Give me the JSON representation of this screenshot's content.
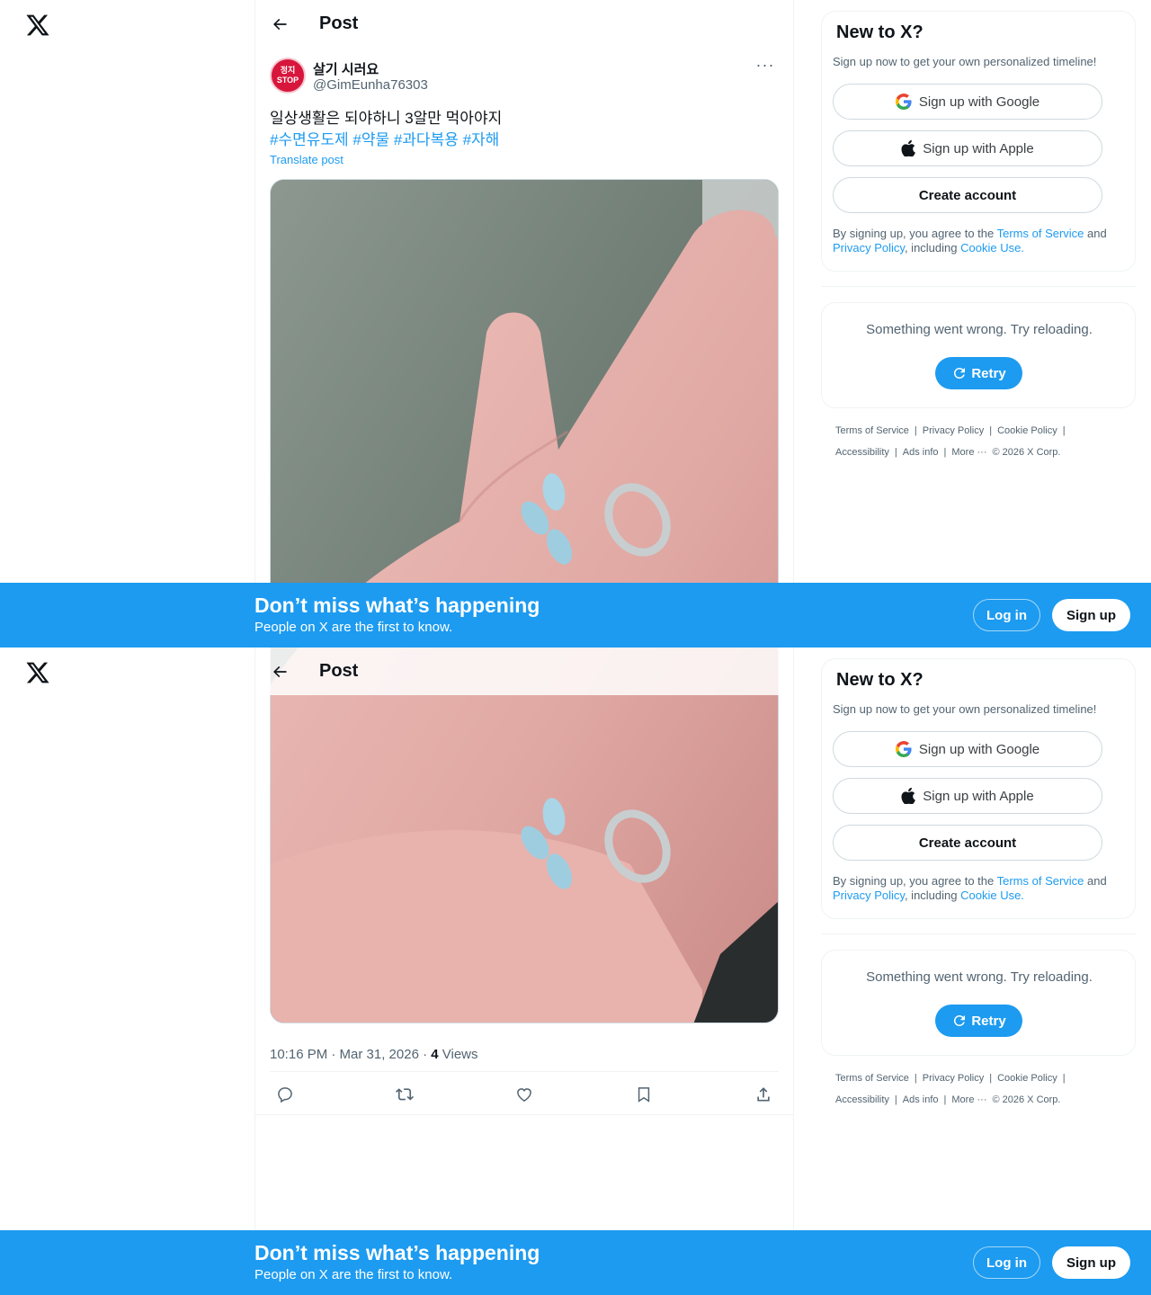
{
  "header": {
    "title": "Post"
  },
  "post": {
    "display_name": "살기 시러요",
    "handle": "@GimEunha76303",
    "avatar_text_1": "정지",
    "avatar_text_2": "STOP",
    "more": "···",
    "text": "일상생활은 되야하니 3알만 먹아야지",
    "hashtags": "#수면유도제 #약물 #과다복용 #자해",
    "translate": "Translate post",
    "time": "10:16 PM · Mar 31, 2026 · ",
    "views_count": "4",
    "views_label": " Views"
  },
  "signup_card": {
    "title": "New to X?",
    "subtitle": "Sign up now to get your own personalized timeline!",
    "google": "Sign up with Google",
    "apple": "Sign up with Apple",
    "create": "Create account",
    "legal_1": "By signing up, you agree to the ",
    "tos": "Terms of Service",
    "legal_2": " and ",
    "privacy": "Privacy Policy",
    "legal_3": ", including ",
    "cookie": "Cookie Use."
  },
  "error_card": {
    "message": "Something went wrong. Try reloading.",
    "retry": "Retry"
  },
  "footer": {
    "terms": "Terms of Service",
    "privacy": "Privacy Policy",
    "cookie": "Cookie Policy",
    "accessibility": "Accessibility",
    "ads": "Ads info",
    "more": "More ···",
    "copyright": "© 2026 X Corp."
  },
  "banner": {
    "title": "Don’t miss what’s happening",
    "subtitle": "People on X are the first to know.",
    "login": "Log in",
    "signup": "Sign up"
  },
  "colors": {
    "accent": "#1d9bf0",
    "text": "#0f1419",
    "muted": "#536471"
  }
}
